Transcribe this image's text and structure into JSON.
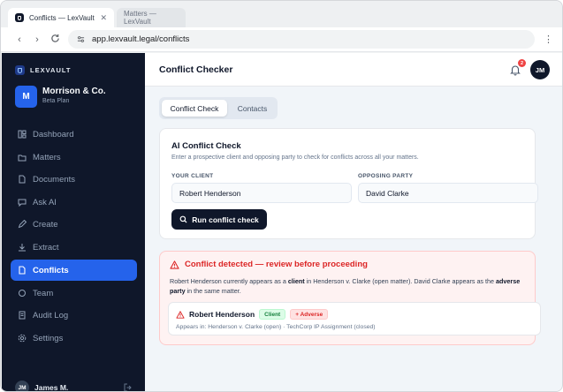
{
  "browser": {
    "active_tab_title": "Conflicts — LexVault",
    "inactive_tab_title": "Matters — LexVault",
    "url": "app.lexvault.legal/conflicts"
  },
  "sidebar": {
    "brand": "LEXVAULT",
    "org": {
      "initial": "M",
      "name": "Morrison & Co.",
      "plan": "Beta Plan"
    },
    "items": [
      {
        "label": "Dashboard",
        "icon": "dashboard-icon"
      },
      {
        "label": "Matters",
        "icon": "matters-icon"
      },
      {
        "label": "Documents",
        "icon": "documents-icon"
      },
      {
        "label": "Ask AI",
        "icon": "ask-ai-icon"
      },
      {
        "label": "Create",
        "icon": "create-icon"
      },
      {
        "label": "Extract",
        "icon": "extract-icon"
      },
      {
        "label": "Conflicts",
        "icon": "conflicts-icon",
        "active": true
      },
      {
        "label": "Team",
        "icon": "team-icon"
      },
      {
        "label": "Audit Log",
        "icon": "audit-log-icon"
      },
      {
        "label": "Settings",
        "icon": "settings-icon"
      }
    ],
    "user": {
      "initials": "JM",
      "name": "James M."
    }
  },
  "header": {
    "title": "Conflict Checker",
    "notification_count": "2",
    "avatar_initials": "JM"
  },
  "tabs": [
    {
      "label": "Conflict Check",
      "active": true
    },
    {
      "label": "Contacts",
      "active": false
    }
  ],
  "check_card": {
    "title": "AI Conflict Check",
    "subtitle": "Enter a prospective client and opposing party to check for conflicts across all your matters.",
    "client_label": "YOUR CLIENT",
    "client_value": "Robert Henderson",
    "opposing_label": "OPPOSING PARTY",
    "opposing_value": "David Clarke",
    "run_button": "Run conflict check"
  },
  "result": {
    "heading": "Conflict detected — review before proceeding",
    "body_1": "Robert Henderson currently appears as a ",
    "body_client": "client",
    "body_2": " in Henderson v. Clarke (open matter). David Clarke appears as the ",
    "body_adverse": "adverse party",
    "body_3": " in the same matter.",
    "match": {
      "name": "Robert Henderson",
      "badge_client": "Client",
      "badge_adverse": "+ Adverse",
      "appears_in": "Appears in: Henderson v. Clarke (open) · TechCorp IP Assignment (closed)"
    }
  },
  "colors": {
    "sidebar_bg": "#0f172a",
    "accent": "#2563eb",
    "danger": "#dc2626",
    "success": "#15803d"
  }
}
